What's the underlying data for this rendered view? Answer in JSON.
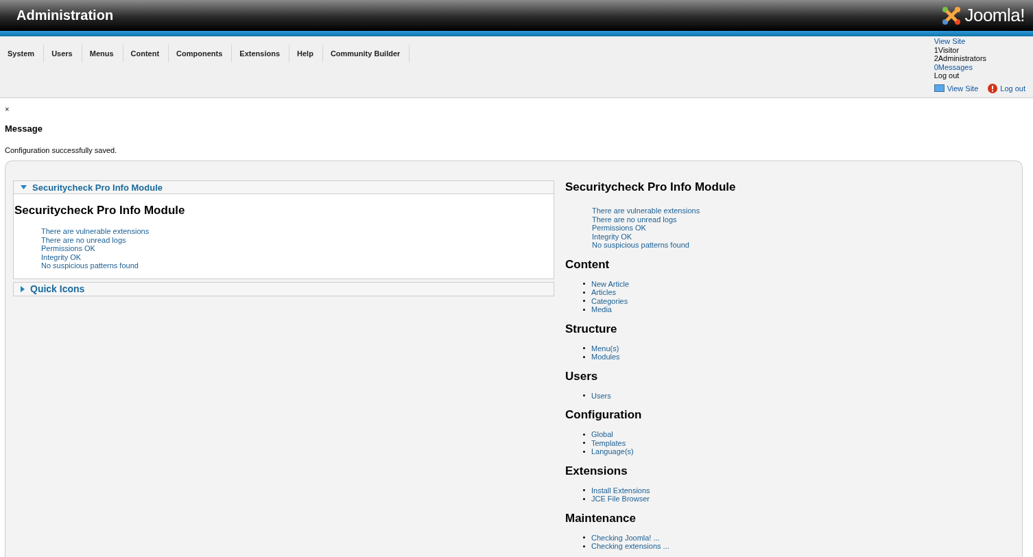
{
  "header": {
    "title": "Administration",
    "logo_text": "Joomla!"
  },
  "menu": [
    "System",
    "Users",
    "Menus",
    "Content",
    "Components",
    "Extensions",
    "Help",
    "Community Builder"
  ],
  "status": [
    {
      "kind": "link",
      "text": "View Site"
    },
    {
      "kind": "plain",
      "text": "1Visitor"
    },
    {
      "kind": "plain",
      "text": "2Administrators"
    },
    {
      "kind": "link",
      "text": "0Messages"
    },
    {
      "kind": "plain",
      "text": "Log out"
    }
  ],
  "status_buttons": [
    {
      "kind": "view",
      "label": "View Site"
    },
    {
      "kind": "logout",
      "label": "Log out"
    }
  ],
  "message": {
    "close": "×",
    "heading": "Message",
    "text": "Configuration successfully saved."
  },
  "panels": [
    {
      "title": "Securitycheck Pro Info Module",
      "expanded": true,
      "heading": "Securitycheck Pro Info Module",
      "lines": [
        "There are vulnerable extensions",
        "There are no unread logs",
        "Permissions OK",
        "Integrity OK",
        "No suspicious patterns found"
      ]
    },
    {
      "title": "Quick Icons",
      "expanded": false
    }
  ],
  "side": {
    "heading": "Securitycheck Pro Info Module",
    "lines": [
      "There are vulnerable extensions",
      "There are no unread logs",
      "Permissions OK",
      "Integrity OK",
      "No suspicious patterns found"
    ],
    "sections": [
      {
        "heading": "Content",
        "links": [
          "New Article",
          "Articles",
          "Categories",
          "Media"
        ]
      },
      {
        "heading": "Structure",
        "links": [
          "Menu(s)",
          "Modules"
        ]
      },
      {
        "heading": "Users",
        "links": [
          "Users"
        ]
      },
      {
        "heading": "Configuration",
        "links": [
          "Global",
          "Templates",
          "Language(s)"
        ]
      },
      {
        "heading": "Extensions",
        "links": [
          "Install Extensions",
          "JCE File Browser"
        ]
      },
      {
        "heading": "Maintenance",
        "links": [
          "Checking Joomla! ...",
          "Checking extensions ..."
        ]
      }
    ]
  }
}
